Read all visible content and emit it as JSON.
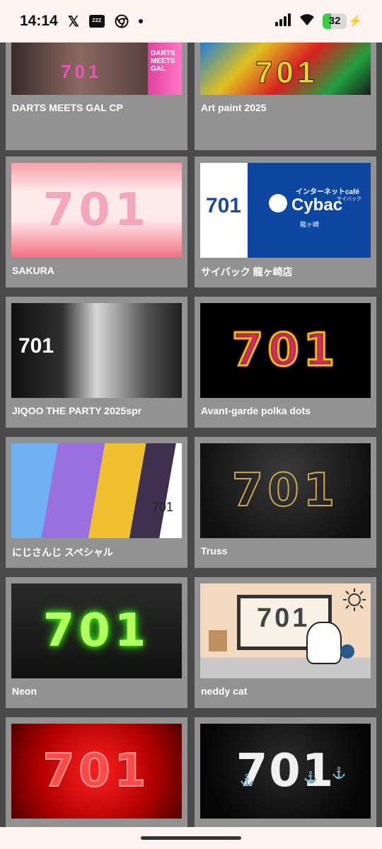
{
  "status_bar": {
    "time": "14:14",
    "x_icon": "x-logo",
    "battery_level": "32",
    "icons": [
      "x-icon",
      "app-icon",
      "chrome-icon",
      "dot-icon",
      "signal-icon",
      "wifi-icon",
      "battery-icon",
      "charging-icon"
    ]
  },
  "cards": [
    {
      "title": "DARTS MEETS GAL CP",
      "thumb_text": "701",
      "sub_text": "DARTS MEETS GAL"
    },
    {
      "title": "Art paint 2025",
      "thumb_text": "701"
    },
    {
      "title": "SAKURA",
      "thumb_text": "701"
    },
    {
      "title": "サイバック 龍ヶ崎店",
      "thumb_text": "701",
      "logo_brand": "Cybac",
      "logo_top": "インターネットcafé",
      "logo_kana": "サイバック",
      "logo_sub": "龍ヶ崎"
    },
    {
      "title": "JIQOO THE PARTY 2025spr",
      "thumb_text": "701"
    },
    {
      "title": "Avant-garde polka dots",
      "thumb_text": "701"
    },
    {
      "title": "にじさんじ スペシャル",
      "thumb_text": "701"
    },
    {
      "title": "Truss",
      "thumb_text": "701"
    },
    {
      "title": "Neon",
      "thumb_text": "701"
    },
    {
      "title": "neddy cat",
      "thumb_text": "701"
    },
    {
      "title": "",
      "thumb_text": "701"
    },
    {
      "title": "",
      "thumb_text": "701"
    }
  ]
}
